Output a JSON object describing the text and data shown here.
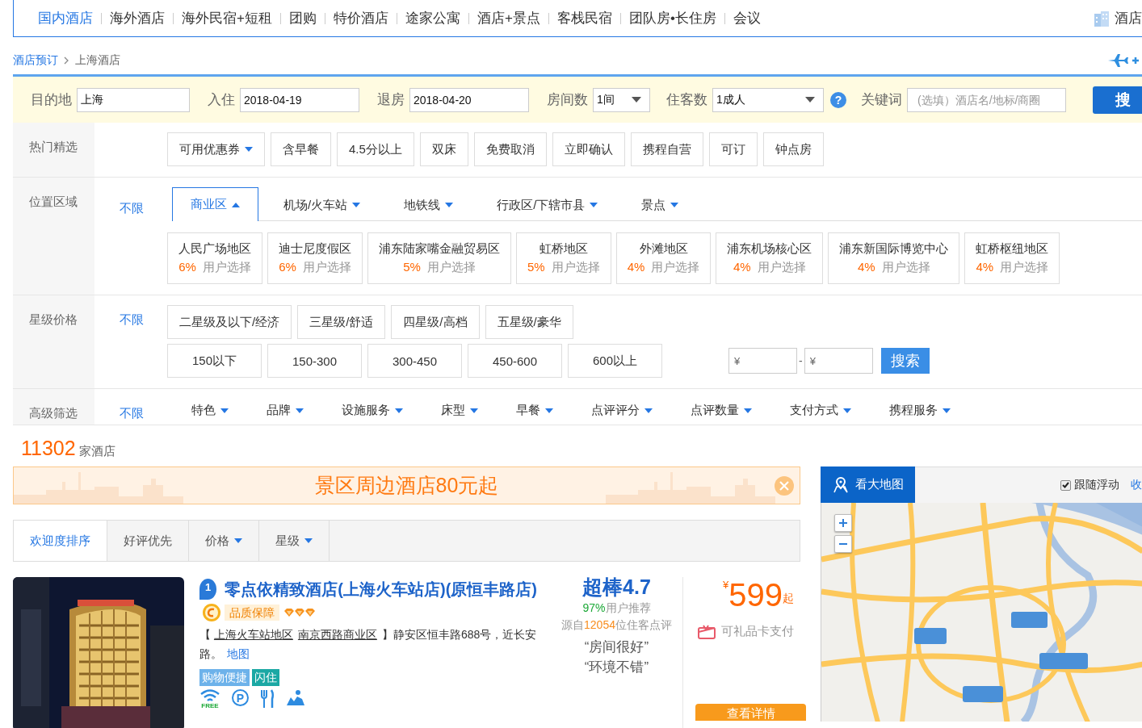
{
  "top_nav": {
    "items": [
      {
        "label": "国内酒店",
        "selected": true
      },
      {
        "label": "海外酒店",
        "selected": false
      },
      {
        "label": "海外民宿+短租",
        "selected": false
      },
      {
        "label": "团购",
        "selected": false
      },
      {
        "label": "特价酒店",
        "selected": false
      },
      {
        "label": "途家公寓",
        "selected": false
      },
      {
        "label": "酒店+景点",
        "selected": false
      },
      {
        "label": "客栈民宿",
        "selected": false
      },
      {
        "label": "团队房•长住房",
        "selected": false
      },
      {
        "label": "会议",
        "selected": false
      }
    ],
    "right_link": "酒店"
  },
  "breadcrumb": [
    "酒店预订",
    "上海酒店"
  ],
  "search": {
    "destination": {
      "label": "目的地",
      "value": "上海"
    },
    "checkin": {
      "label": "入住",
      "value": "2018-04-19"
    },
    "checkout": {
      "label": "退房",
      "value": "2018-04-20"
    },
    "rooms": {
      "label": "房间数",
      "value": "1间"
    },
    "guests": {
      "label": "住客数",
      "value": "1成人"
    },
    "help": "?",
    "keyword": {
      "label": "关键词",
      "placeholder": "(选填）酒店名/地标/商圈"
    },
    "button": "搜"
  },
  "filters": {
    "hot": {
      "label": "热门精选",
      "options": [
        {
          "label": "可用优惠券",
          "dropdown": true
        },
        {
          "label": "含早餐",
          "dropdown": false
        },
        {
          "label": "4.5分以上",
          "dropdown": false
        },
        {
          "label": "双床",
          "dropdown": false
        },
        {
          "label": "免费取消",
          "dropdown": false
        },
        {
          "label": "立即确认",
          "dropdown": false
        },
        {
          "label": "携程自营",
          "dropdown": false
        },
        {
          "label": "可订",
          "dropdown": false
        },
        {
          "label": "钟点房",
          "dropdown": false
        }
      ]
    },
    "location": {
      "label": "位置区域",
      "any": "不限",
      "tabs": [
        {
          "label": "商业区",
          "selected": true
        },
        {
          "label": "机场/火车站",
          "selected": false
        },
        {
          "label": "地铁线",
          "selected": false
        },
        {
          "label": "行政区/下辖市县",
          "selected": false
        },
        {
          "label": "景点",
          "selected": false
        }
      ],
      "areas": [
        {
          "name": "人民广场地区",
          "share": "6%",
          "note": "用户选择"
        },
        {
          "name": "迪士尼度假区",
          "share": "6%",
          "note": "用户选择"
        },
        {
          "name": "浦东陆家嘴金融贸易区",
          "share": "5%",
          "note": "用户选择"
        },
        {
          "name": "虹桥地区",
          "share": "5%",
          "note": "用户选择"
        },
        {
          "name": "外滩地区",
          "share": "4%",
          "note": "用户选择"
        },
        {
          "name": "浦东机场核心区",
          "share": "4%",
          "note": "用户选择"
        },
        {
          "name": "浦东新国际博览中心",
          "share": "4%",
          "note": "用户选择"
        },
        {
          "name": "虹桥枢纽地区",
          "share": "4%",
          "note": "用户选择"
        }
      ]
    },
    "star_price": {
      "label": "星级价格",
      "any": "不限",
      "stars": [
        "二星级及以下/经济",
        "三星级/舒适",
        "四星级/高档",
        "五星级/豪华"
      ],
      "prices": [
        "150以下",
        "150-300",
        "300-450",
        "450-600",
        "600以上"
      ],
      "min_placeholder": "¥",
      "separator": "-",
      "max_placeholder": "¥",
      "button": "搜索"
    },
    "advanced": {
      "label": "高级筛选",
      "any": "不限",
      "options": [
        "特色",
        "品牌",
        "设施服务",
        "床型",
        "早餐",
        "点评评分",
        "点评数量",
        "支付方式",
        "携程服务"
      ]
    }
  },
  "result_count": {
    "number": "11302",
    "unit": "家酒店"
  },
  "banner": {
    "text": "景区周边酒店80元起"
  },
  "sort_tabs": [
    {
      "label": "欢迎度排序",
      "selected": true,
      "dropdown": false
    },
    {
      "label": "好评优先",
      "selected": false,
      "dropdown": false
    },
    {
      "label": "价格",
      "selected": false,
      "dropdown": true
    },
    {
      "label": "星级",
      "selected": false,
      "dropdown": true
    }
  ],
  "hotel": {
    "rank": "1",
    "name": "零点依精致酒店(上海火车站店)(原恒丰路店)",
    "badge": "品质保障",
    "stars": 3,
    "address_open": "【 ",
    "areas": [
      "上海火车站地区",
      "南京西路商业区"
    ],
    "address_rest": "】静安区恒丰路688号，近长安路。",
    "map_link": "地图",
    "tags": [
      {
        "label": "购物便捷",
        "color": "#6db2ea"
      },
      {
        "label": "闪住",
        "color": "#1ba8a4"
      }
    ],
    "amenities": [
      {
        "kind": "wifi",
        "label": "FREE"
      },
      {
        "kind": "parking",
        "label": "P"
      },
      {
        "kind": "dining"
      },
      {
        "kind": "pickup"
      }
    ],
    "score": "超棒4.7",
    "recommend_share": "97%",
    "recommend_text": "用户推荐",
    "review_pre": "源自",
    "review_count": "12054",
    "review_post": "位住客点评",
    "quotes": [
      "“房间很好”",
      "“环境不错”"
    ],
    "currency": "¥",
    "price": "599",
    "price_suffix": "起",
    "gift_card": "可礼品卡支付",
    "details_button": "查看详情"
  },
  "map": {
    "button": "看大地图",
    "follow": {
      "label": "跟随浮动",
      "checked": true
    },
    "collapse": "收"
  }
}
